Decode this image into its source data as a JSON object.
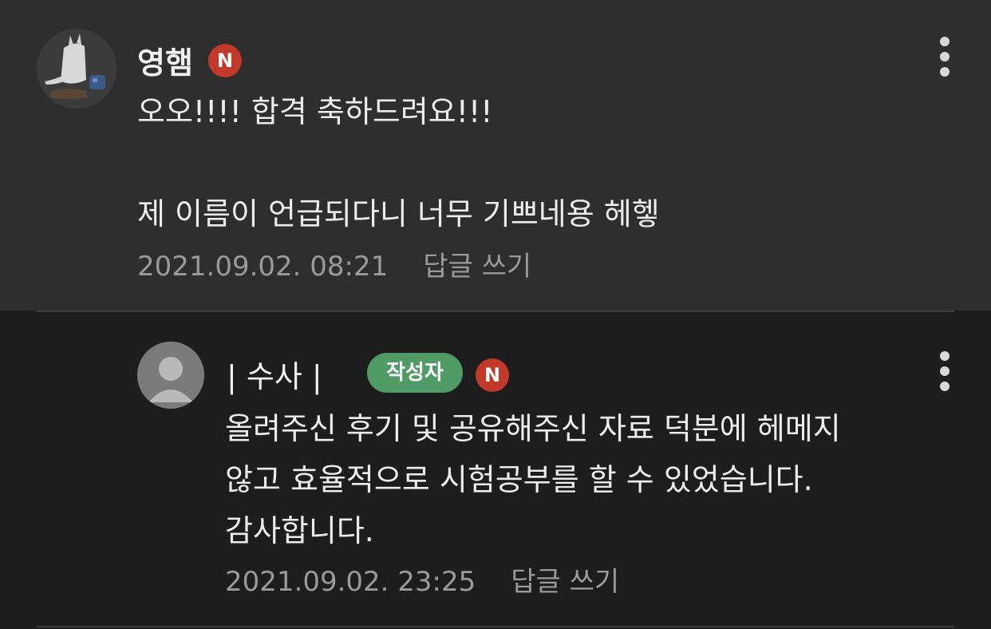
{
  "comments": [
    {
      "author": "영햄",
      "badge": "N",
      "text": "오오!!!! 합격 축하드려요!!!\n\n제 이름이 언급되다니 너무 기쁘네용 헤헿",
      "date": "2021.09.02. 08:21",
      "reply_label": "답글 쓰기",
      "avatar_icon": "bunny-figure-avatar-icon",
      "more_icon": "more-vertical-icon"
    },
    {
      "author": "| 수사 |",
      "author_tag": "작성자",
      "badge": "N",
      "text": "올려주신 후기 및 공유해주신 자료 덕분에 헤메지\n않고 효율적으로 시험공부를 할 수 있었습니다.\n감사합니다.",
      "date": "2021.09.02. 23:25",
      "reply_label": "답글 쓰기",
      "avatar_icon": "default-user-avatar-icon",
      "more_icon": "more-vertical-icon"
    }
  ],
  "colors": {
    "top_background": "#2e2e2e",
    "reply_background": "#1d1d1d",
    "badge_new": "#c0392b",
    "author_tag": "#4f9a65"
  }
}
